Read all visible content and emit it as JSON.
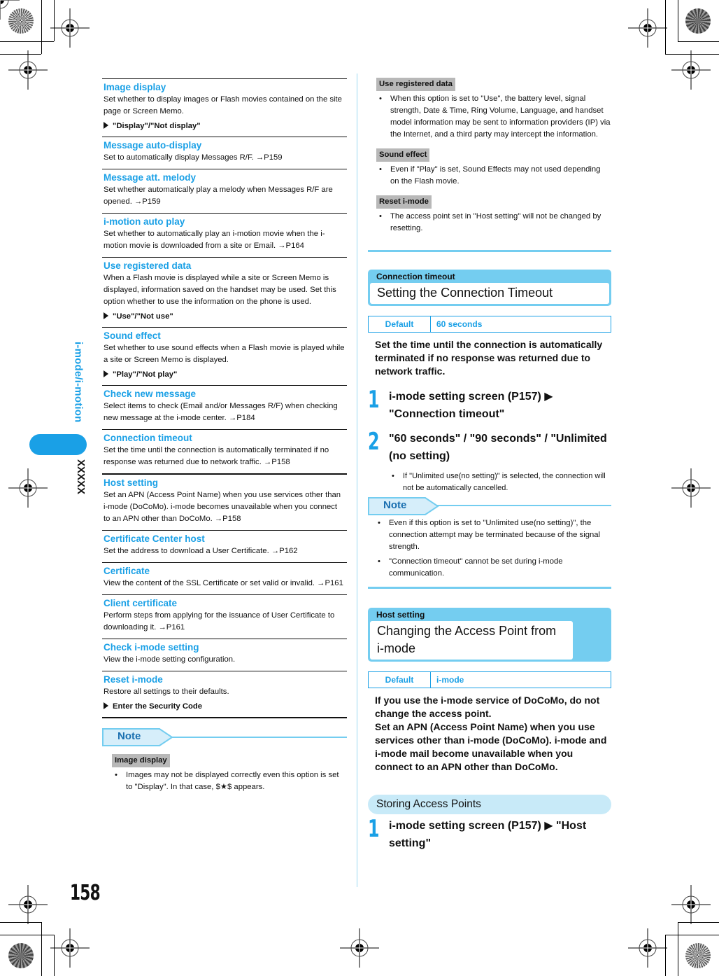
{
  "side_tab": {
    "section_title": "i-mode/i-motion",
    "chapter_code": "XXXXX"
  },
  "page_number": "158",
  "left_column": {
    "entries": [
      {
        "title": "Image display",
        "desc": "Set whether to display images or Flash movies contained on the site page or Screen Memo.",
        "option": "\"Display\"/\"Not display\""
      },
      {
        "title": "Message auto-display",
        "desc": "Set to automatically display Messages R/F. →P159"
      },
      {
        "title": "Message att. melody",
        "desc": "Set whether automatically play a melody when Messages R/F are opened. →P159"
      },
      {
        "title": "i-motion auto play",
        "desc": "Set whether to automatically play an i-motion movie when the i-motion movie is downloaded from a site or Email. →P164"
      },
      {
        "title": "Use registered data",
        "desc": "When a Flash movie is displayed while a site or Screen Memo is displayed, information saved on the handset may be used. Set this option whether to use the information on the phone is used.",
        "option": "\"Use\"/\"Not use\""
      },
      {
        "title": "Sound effect",
        "desc": "Set whether to use sound effects when a Flash movie is played while a site or Screen Memo is displayed.",
        "option": "\"Play\"/\"Not play\""
      },
      {
        "title": "Check new message",
        "desc": "Select items to check (Email and/or Messages R/F) when checking new message at the i-mode center. →P184"
      },
      {
        "title": "Connection timeout",
        "desc": "Set the time until the connection is automatically terminated if no response was returned due to network traffic. →P158"
      },
      {
        "title": "Host setting",
        "desc": "Set an APN (Access Point Name) when you use services other than i-mode (DoCoMo). i-mode becomes unavailable when you connect to an APN other than DoCoMo. →P158"
      },
      {
        "title": "Certificate Center host",
        "desc": "Set the address to download a User Certificate. →P162"
      },
      {
        "title": "Certificate",
        "desc": "View the content of the SSL Certificate or set valid or invalid. →P161"
      },
      {
        "title": "Client certificate",
        "desc": "Perform steps from applying for the issuance of User Certificate to downloading it. →P161"
      },
      {
        "title": "Check i-mode setting",
        "desc": "View the i-mode setting configuration."
      },
      {
        "title": "Reset i-mode",
        "desc": "Restore all settings to their defaults.",
        "option": "Enter the Security Code"
      }
    ],
    "note": {
      "label": "Note",
      "items": [
        {
          "heading": "Image display",
          "bullets": [
            "Images may not be displayed correctly even this option is set to \"Display\". In that case, $★$ appears."
          ]
        }
      ]
    }
  },
  "right_column": {
    "note_continued": [
      {
        "heading": "Use registered data",
        "bullets": [
          "When this option is set to \"Use\", the battery level, signal strength, Date & Time, Ring Volume, Language, and handset model information may be sent to information providers (IP) via the Internet, and a third party may intercept the information."
        ]
      },
      {
        "heading": "Sound effect",
        "bullets": [
          "Even if \"Play\" is set, Sound Effects may not used depending on the Flash movie."
        ]
      },
      {
        "heading": "Reset i-mode",
        "bullets": [
          "The access point set in \"Host setting\" will not be changed by resetting."
        ]
      }
    ],
    "connection_timeout": {
      "tag": "Connection timeout",
      "title": "Setting the Connection Timeout",
      "default_label": "Default",
      "default_value": "60 seconds",
      "intro": "Set the time until the connection is automatically terminated if no response was returned due to network traffic.",
      "steps": [
        {
          "num": "1",
          "text": "i-mode setting screen (P157) ▶ \"Connection timeout\""
        },
        {
          "num": "2",
          "text": "\"60 seconds\" / \"90 seconds\" / \"Unlimited (no setting)",
          "bullets": [
            "If \"Unlimited use(no setting)\" is selected, the connection will not be automatically cancelled."
          ]
        }
      ],
      "note_label": "Note",
      "note_bullets": [
        "Even if this option is set to \"Unlimited use(no setting)\", the connection attempt may be terminated because of the signal strength.",
        "\"Connection timeout\" cannot be set during i-mode communication."
      ]
    },
    "host_setting": {
      "tag": "Host setting",
      "title": "Changing the Access Point from i-mode",
      "default_label": "Default",
      "default_value": "i-mode",
      "intro_1": "If you use the i-mode service of DoCoMo, do not change the access point.",
      "intro_2": "Set an APN (Access Point Name) when you use services other than i-mode (DoCoMo). i-mode and i-mode mail become unavailable when you connect to an APN other than DoCoMo.",
      "subsection": "Storing Access Points",
      "steps": [
        {
          "num": "1",
          "text": "i-mode setting screen (P157) ▶ \"Host setting\""
        }
      ]
    }
  }
}
